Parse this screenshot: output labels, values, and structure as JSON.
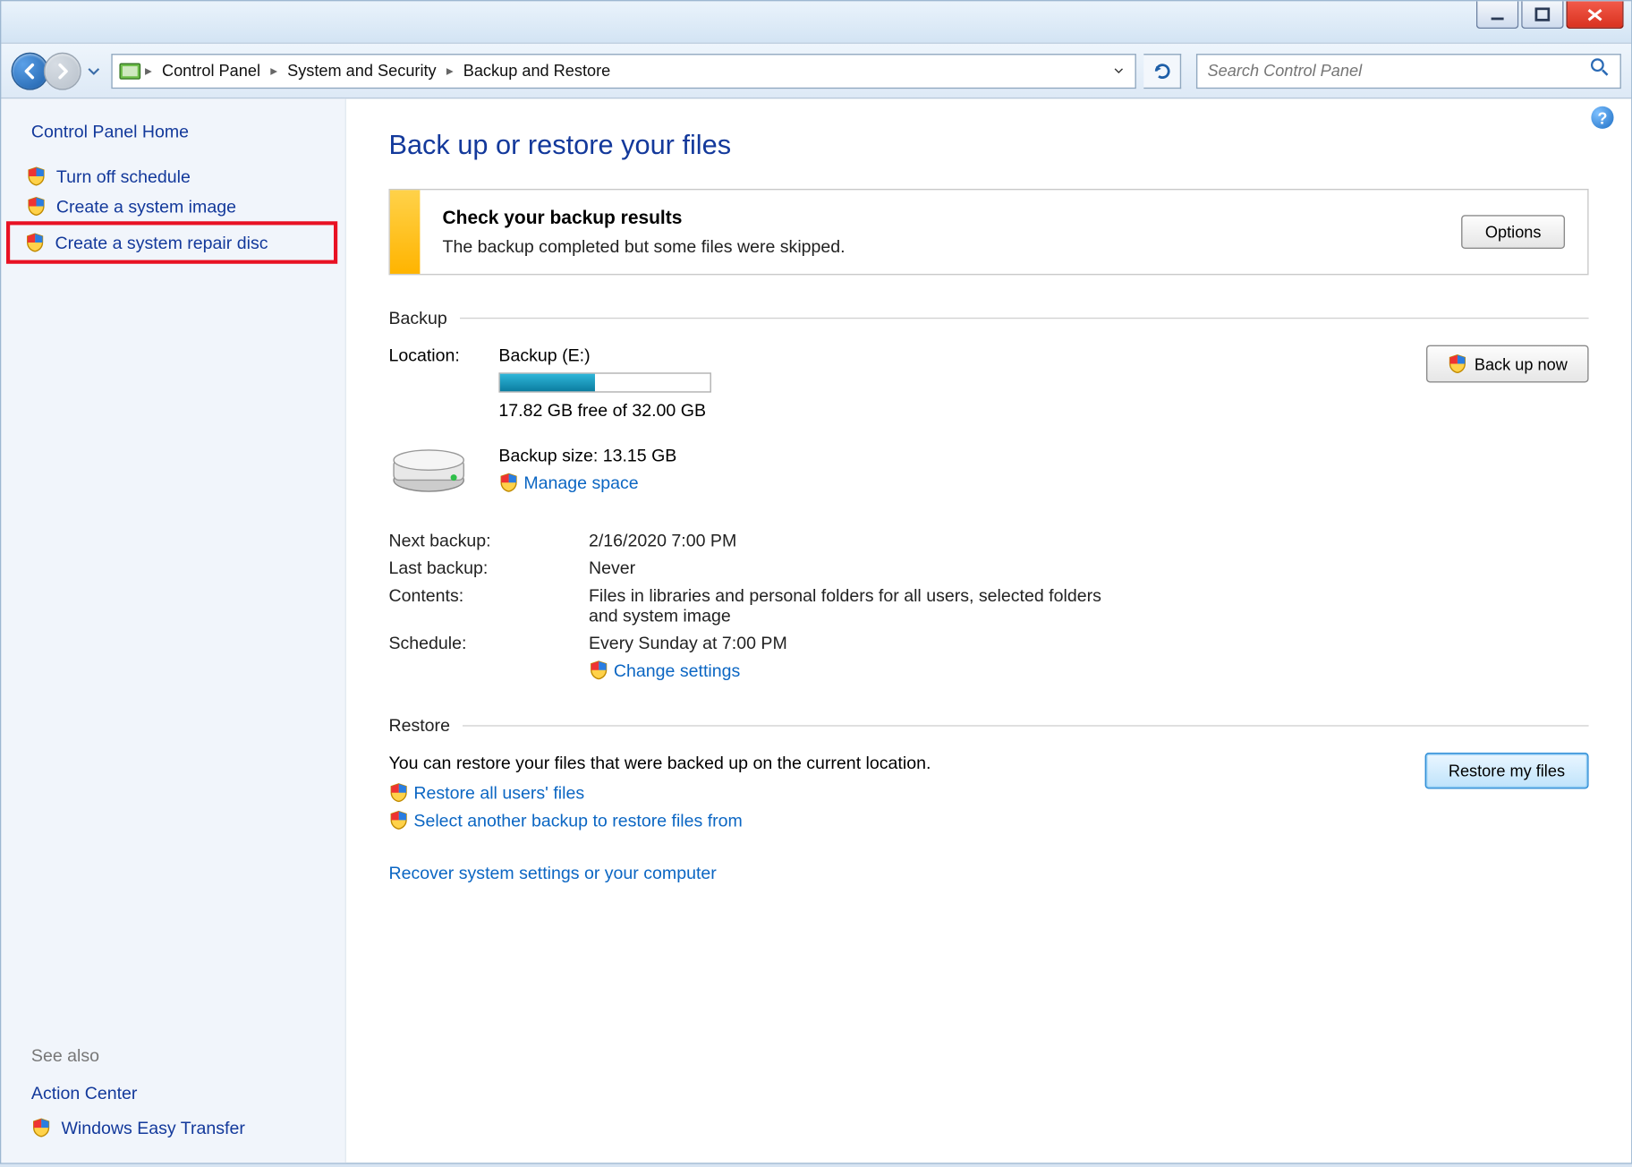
{
  "breadcrumb": {
    "items": [
      "Control Panel",
      "System and Security",
      "Backup and Restore"
    ]
  },
  "search": {
    "placeholder": "Search Control Panel"
  },
  "sidebar": {
    "title": "Control Panel Home",
    "links": {
      "turn_off": "Turn off schedule",
      "create_image": "Create a system image",
      "create_disc": "Create a system repair disc"
    },
    "see_also": "See also",
    "action_center": "Action Center",
    "easy_transfer": "Windows Easy Transfer"
  },
  "page": {
    "title": "Back up or restore your files",
    "alert": {
      "title": "Check your backup results",
      "text": "The backup completed but some files were skipped.",
      "button": "Options"
    },
    "backup": {
      "legend": "Backup",
      "location_label": "Location:",
      "drive": "Backup (E:)",
      "free_space": "17.82 GB free of 32.00 GB",
      "size": "Backup size: 13.15 GB",
      "manage": "Manage space",
      "backup_now": "Back up now",
      "progress_pct": 45,
      "rows": {
        "next_label": "Next backup:",
        "next_val": "2/16/2020 7:00 PM",
        "last_label": "Last backup:",
        "last_val": "Never",
        "contents_label": "Contents:",
        "contents_val": "Files in libraries and personal folders for all users, selected folders and system image",
        "schedule_label": "Schedule:",
        "schedule_val": "Every Sunday at 7:00 PM"
      },
      "change_settings": "Change settings"
    },
    "restore": {
      "legend": "Restore",
      "text": "You can restore your files that were backed up on the current location.",
      "restore_all": "Restore all users' files",
      "select_other": "Select another backup to restore files from",
      "button": "Restore my files",
      "recover": "Recover system settings or your computer"
    }
  }
}
